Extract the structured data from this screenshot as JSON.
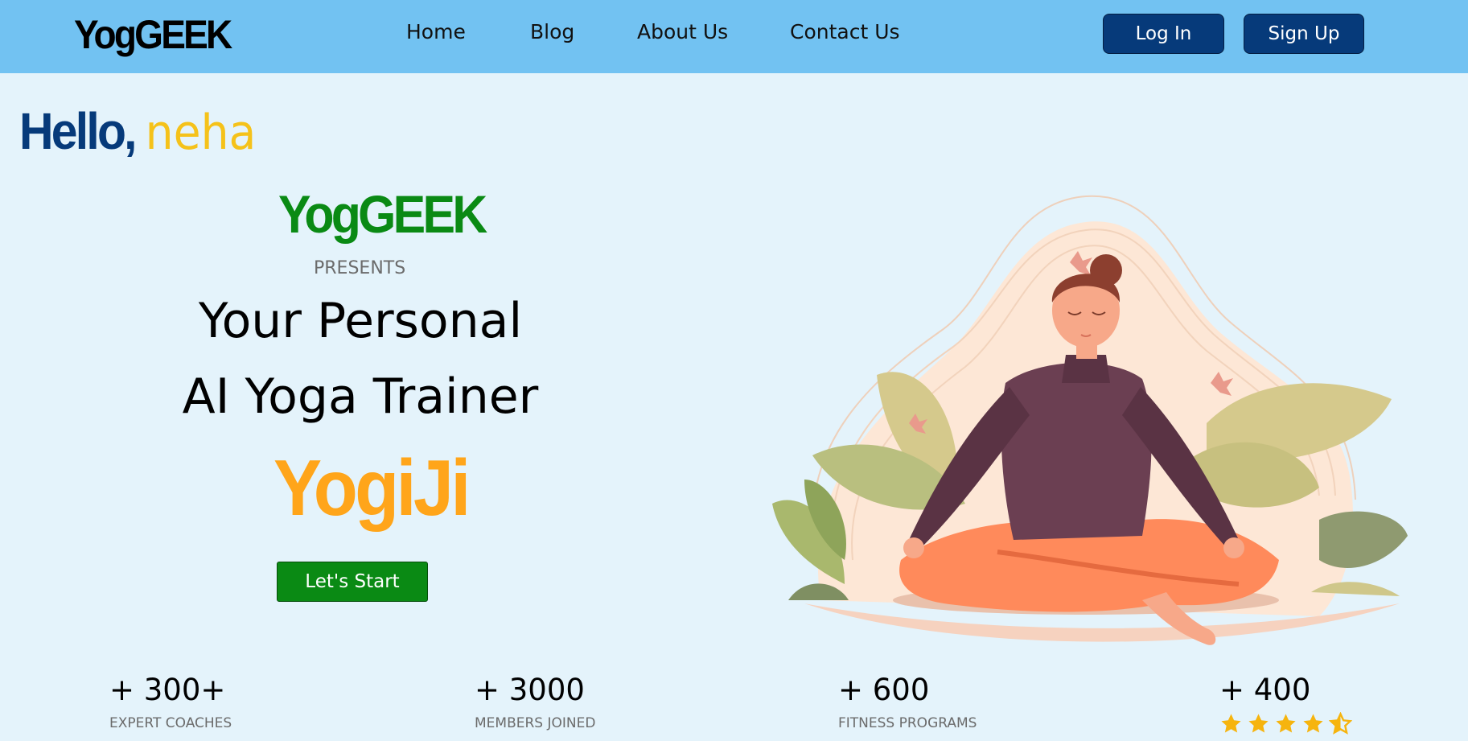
{
  "navbar": {
    "logo": "YogGEEK",
    "links": [
      "Home",
      "Blog",
      "About Us",
      "Contact Us"
    ],
    "login": "Log In",
    "signup": "Sign Up"
  },
  "greeting": {
    "hello": "Hello,",
    "name": "neha"
  },
  "hero": {
    "brand": "YogGEEK",
    "presents": "PRESENTS",
    "line1": "Your Personal",
    "line2": "AI Yoga Trainer",
    "product": "YogiJi",
    "cta": "Let's Start"
  },
  "stats": [
    {
      "number": "+ 300+",
      "label": "EXPERT COACHES"
    },
    {
      "number": "+ 3000",
      "label": "MEMBERS JOINED"
    },
    {
      "number": "+ 600",
      "label": "FITNESS PROGRAMS"
    },
    {
      "number": "+ 400",
      "rating": 4.5
    }
  ],
  "icons": {
    "star": "star-icon",
    "half_star": "half-star-icon"
  },
  "colors": {
    "navbar": "#72c2f2",
    "page_bg": "#e4f3fb",
    "nav_button": "#063a7a",
    "brand_green": "#0a8a14",
    "accent_yellow": "#f5c21a",
    "accent_orange": "#ffa51a",
    "star": "#f6b40e"
  }
}
